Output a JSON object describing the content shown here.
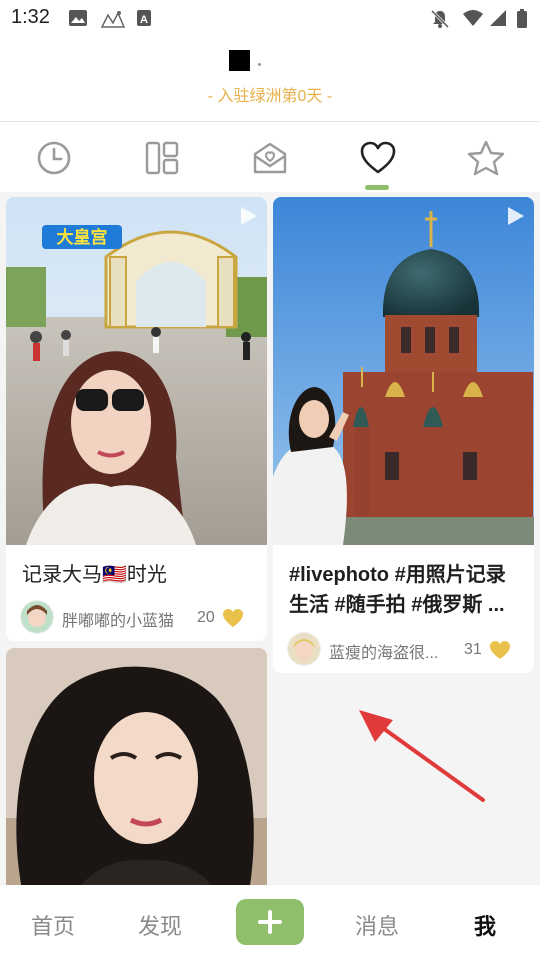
{
  "status_bar": {
    "time": "1:32",
    "left_icons": [
      "image-icon",
      "sketch-app-icon",
      "a-letter-icon"
    ],
    "right_icons": [
      "notifications-off-icon",
      "wifi-icon",
      "signal-icon",
      "battery-icon"
    ]
  },
  "profile": {
    "join_text": "- 入驻绿洲第0天 -"
  },
  "tabs": [
    {
      "icon": "history-clock-icon",
      "active": false
    },
    {
      "icon": "grid-layout-icon",
      "active": false
    },
    {
      "icon": "heart-envelope-icon",
      "active": false
    },
    {
      "icon": "heart-icon",
      "active": true
    },
    {
      "icon": "star-icon",
      "active": false
    }
  ],
  "feed": {
    "cards": [
      {
        "title": "记录大马🇲🇾时光",
        "author": "胖嘟嘟的小蓝猫",
        "likes": "20",
        "image_caption": "大皇宫",
        "is_video": true
      },
      {
        "title": "#livephoto #用照片记录生活 #随手拍 #俄罗斯 ...",
        "author": "蓝瘦的海盗很...",
        "likes": "31",
        "is_video": true
      },
      {
        "title": "",
        "author": "",
        "likes": "",
        "is_video": false
      }
    ]
  },
  "bottom_nav": {
    "home": "首页",
    "discover": "发现",
    "add": "+",
    "messages": "消息",
    "me": "我"
  },
  "colors": {
    "accent_green": "#8fbf6a",
    "join_gold": "#e6b14a",
    "like_heart": "#e8c24a",
    "annotation_arrow": "#e03a3a"
  }
}
